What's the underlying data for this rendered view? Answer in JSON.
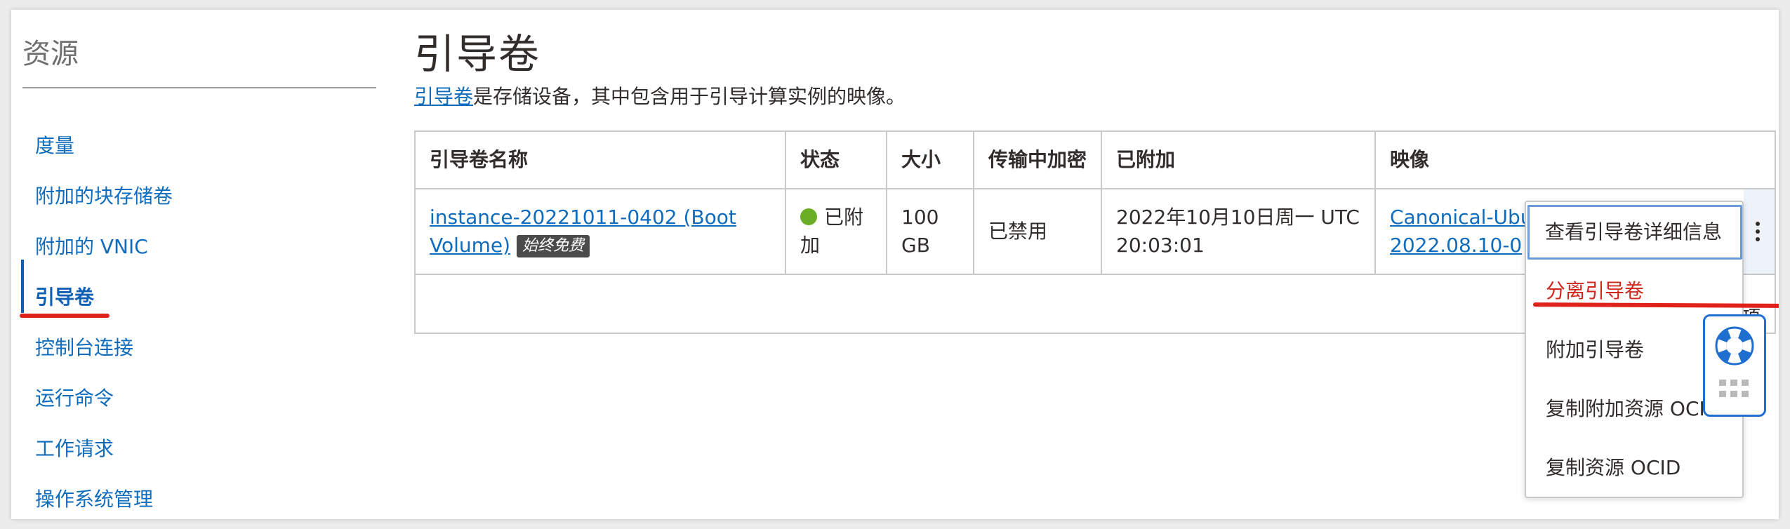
{
  "sidebar": {
    "title": "资源",
    "items": [
      {
        "label": "度量"
      },
      {
        "label": "附加的块存储卷"
      },
      {
        "label": "附加的 VNIC"
      },
      {
        "label": "引导卷"
      },
      {
        "label": "控制台连接"
      },
      {
        "label": "运行命令"
      },
      {
        "label": "工作请求"
      },
      {
        "label": "操作系统管理"
      }
    ],
    "active_index": 3
  },
  "main": {
    "title": "引导卷",
    "description_link": "引导卷",
    "description_text": "是存储设备，其中包含用于引导计算实例的映像。"
  },
  "table": {
    "headers": [
      "引导卷名称",
      "状态",
      "大小",
      "传输中加密",
      "已附加",
      "映像"
    ],
    "row": {
      "name_line1": "instance-20221011-0402 (Boot",
      "name_line2": "Volume)",
      "badge": "始终免费",
      "status_line1": "已附",
      "status_line2": "加",
      "size_line1": "100",
      "size_line2": "GB",
      "encryption": "已禁用",
      "attached_line1": "2022年10月10日周一 UTC",
      "attached_line2": "20:03:01",
      "image_line1": "Canonical-Ubu",
      "image_line2": "2022.08.10-0"
    }
  },
  "menu": {
    "items": [
      {
        "label": "查看引导卷详细信息"
      },
      {
        "label": "分离引导卷"
      },
      {
        "label": "附加引导卷"
      },
      {
        "label": "复制附加资源 OCID"
      },
      {
        "label": "复制资源 OCID"
      }
    ]
  },
  "partial_text": "项",
  "colors": {
    "link": "#0f6cbd",
    "danger": "#d0271d",
    "annotation_red": "#e0221c",
    "status_green": "#6bad24",
    "help_blue": "#1f6fd1"
  },
  "icons": {
    "status": "status-dot-icon",
    "row_actions": "kebab-menu-icon",
    "help": "lifebuoy-icon",
    "drag": "grip-icon"
  }
}
